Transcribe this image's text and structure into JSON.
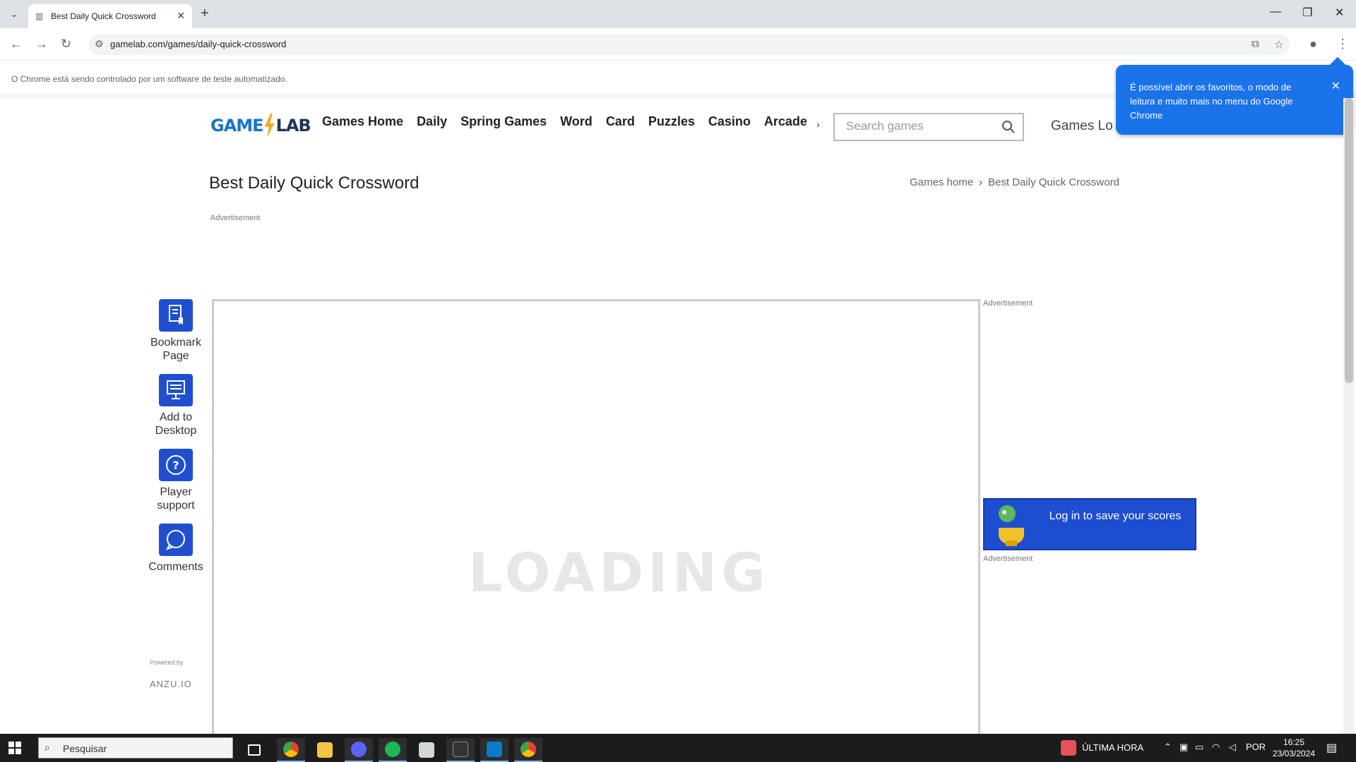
{
  "browser": {
    "tab_title": "Best Daily Quick Crossword",
    "new_tab_symbol": "+",
    "address": "gamelab.com/games/daily-quick-crossword",
    "infobar_text": "O Chrome está sendo controlado por um software de teste automatizado.",
    "bubble_text": "É possível abrir os favoritos, o modo de leitura e muito mais no menu do Google Chrome"
  },
  "site": {
    "logo_part1": "GAME",
    "logo_part2": "LAB",
    "nav": [
      "Games Home",
      "Daily",
      "Spring Games",
      "Word",
      "Card",
      "Puzzles",
      "Casino",
      "Arcade"
    ],
    "search_placeholder": "Search games",
    "games_lounge": "Games Lo"
  },
  "page": {
    "title": "Best Daily Quick Crossword",
    "breadcrumb": [
      "Games home",
      "Best Daily Quick Crossword"
    ],
    "ad_label": "Advertisement",
    "tools": [
      {
        "label_1": "Bookmark",
        "label_2": "Page"
      },
      {
        "label_1": "Add to",
        "label_2": "Desktop"
      },
      {
        "label_1": "Player",
        "label_2": "support"
      },
      {
        "label_1": "Comments",
        "label_2": ""
      }
    ],
    "powered_by": "Powered by",
    "anzu": "ANZU.IO",
    "loading": "LOADING",
    "login_banner": "Log in to save your scores"
  },
  "taskbar": {
    "search_text": "Pesquisar",
    "news": "ÚLTIMA HORA",
    "lang": "POR",
    "time": "16:25",
    "date": "23/03/2024"
  },
  "colors": {
    "accent_blue": "#1f4fcf",
    "chrome_bubble": "#1a73e8",
    "logo_yellow": "#f7a823"
  }
}
